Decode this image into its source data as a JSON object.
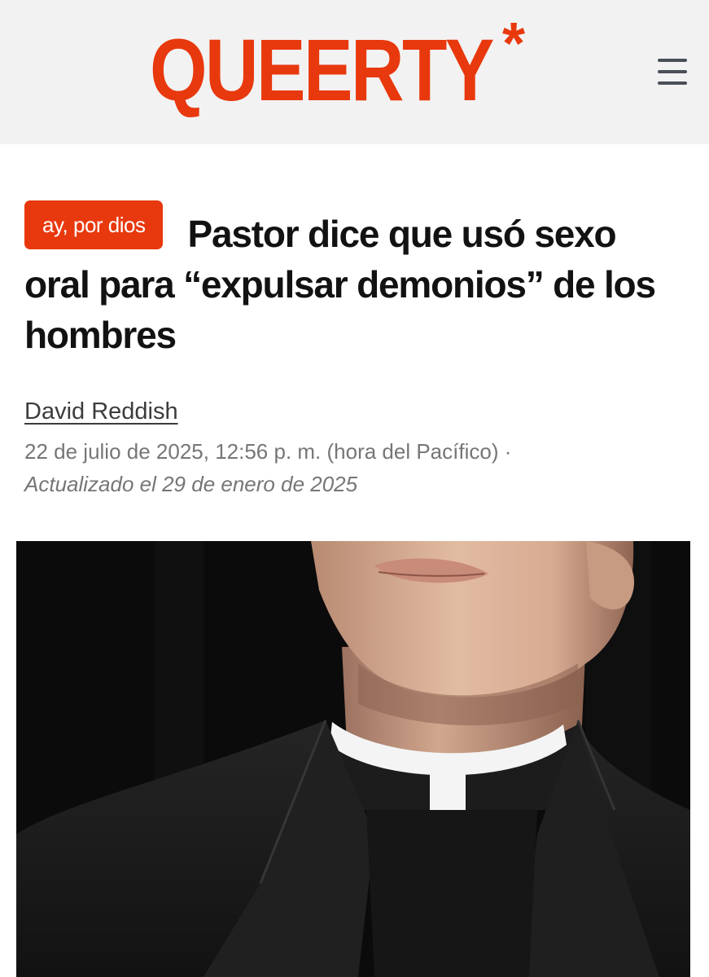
{
  "header": {
    "logo_text": "QUEERTY",
    "logo_mark": "*",
    "brand_color": "#e8380d",
    "menu_icon": "hamburger-menu-icon"
  },
  "article": {
    "tag": "ay, por dios",
    "headline": "Pastor dice que usó sexo oral para “expulsar demonios” de los hombres",
    "author": "David Reddish",
    "published": "22 de julio de 2025, 12:56 p. m. (hora del Pacífico) ·",
    "updated": "Actualizado el 29 de enero de 2025"
  }
}
